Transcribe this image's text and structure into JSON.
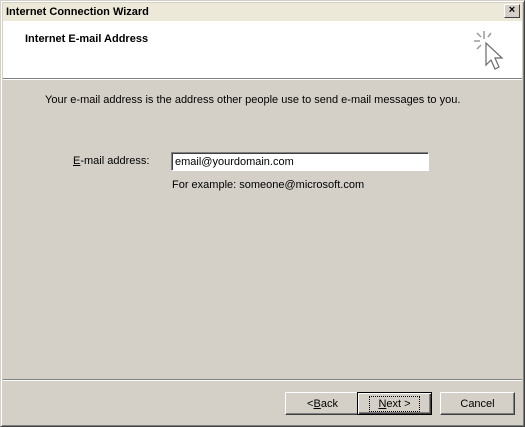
{
  "window": {
    "title": "Internet Connection Wizard",
    "close_glyph": "×"
  },
  "header": {
    "title": "Internet E-mail Address",
    "icon": "wizard-sparkle-cursor-icon"
  },
  "body": {
    "intro": "Your e-mail address is the address other people use to send e-mail messages to you.",
    "email_label_accel": "E",
    "email_label_rest": "-mail address:",
    "email_value": "email@yourdomain.com",
    "example": "For example: someone@microsoft.com"
  },
  "buttons": {
    "back_prefix": "< ",
    "back_accel": "B",
    "back_rest": "ack",
    "next_accel": "N",
    "next_rest": "ext >",
    "cancel": "Cancel"
  }
}
